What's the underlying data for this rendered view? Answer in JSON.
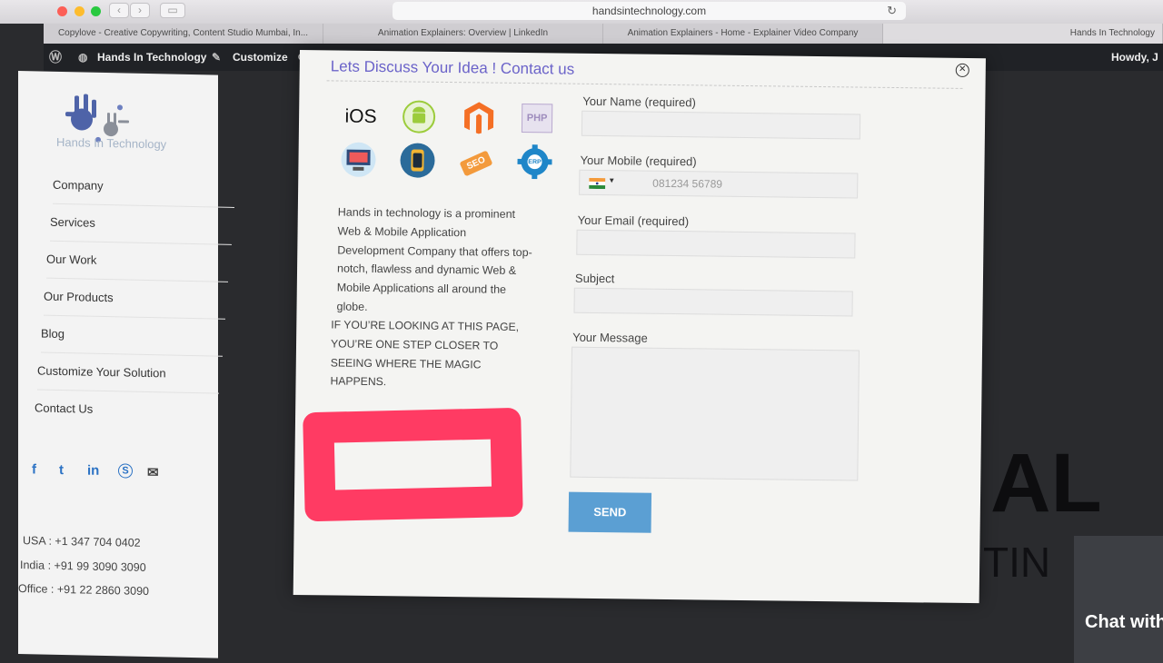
{
  "browser": {
    "url": "handsintechnology.com",
    "tabs": [
      "Copylove - Creative Copywriting, Content Studio Mumbai, In...",
      "Animation Explainers: Overview | LinkedIn",
      "Animation Explainers - Home - Explainer Video Company",
      "Hands In Technology"
    ]
  },
  "admin_bar": {
    "site_name": "Hands In Technology",
    "customize_label": "Customize",
    "greeting": "Howdy, J"
  },
  "sidebar": {
    "logo_text": "Hands In Technology",
    "menu": [
      "Company",
      "Services",
      "Our Work",
      "Our Products",
      "Blog",
      "Customize Your Solution",
      "Contact Us"
    ],
    "social": [
      "f",
      "t",
      "in",
      "S",
      "✉"
    ],
    "contacts": [
      "USA : +1 347 704 0402",
      "India : +91 99 3090 3090",
      "Office : +91 22 2860 3090"
    ]
  },
  "background": {
    "letters_large": "AL",
    "letters_small": "TIN"
  },
  "chat": {
    "label": "Chat with"
  },
  "modal": {
    "title": "Lets Discuss Your Idea ! Contact us",
    "icons": [
      {
        "name": "ios-icon",
        "label": "iOS"
      },
      {
        "name": "android-icon"
      },
      {
        "name": "magento-icon"
      },
      {
        "name": "php-icon",
        "label": "PHP"
      },
      {
        "name": "web-design-icon"
      },
      {
        "name": "smartwatch-icon"
      },
      {
        "name": "seo-icon",
        "label": "SEO"
      },
      {
        "name": "erp-icon",
        "label": "ERP"
      }
    ],
    "description": "Hands in technology is a prominent Web & Mobile Application Development Company that offers top-notch, flawless and dynamic Web & Mobile Applications all around the globe.",
    "description_caps": "If you’re looking at this page, you’re one step closer to seeing where the magic happens.",
    "form": {
      "name_label": "Your Name (required)",
      "mobile_label": "Your Mobile (required)",
      "mobile_placeholder": "081234 56789",
      "email_label": "Your Email (required)",
      "subject_label": "Subject",
      "message_label": "Your Message",
      "send_label": "SEND"
    }
  },
  "colors": {
    "title": "#6b63c9",
    "send": "#5b9fd3",
    "redaction": "#ff3b63"
  }
}
